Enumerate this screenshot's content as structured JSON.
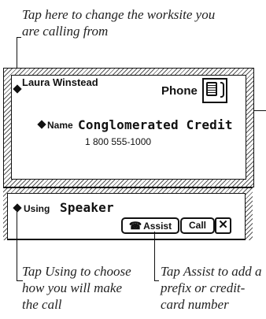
{
  "callouts": {
    "top": "Tap here to change the worksite you are calling from",
    "using": "Tap Using to choose how you will make the call",
    "assist": "Tap Assist to add a prefix or credit-card number"
  },
  "phone_slip": {
    "contact_name": "Laura Winstead",
    "phone_label": "Phone",
    "phone_icon": "telephone-icon",
    "name_label": "Name",
    "name_value": "Conglomerated Credit",
    "number": "1 800 555-1000"
  },
  "call_bar": {
    "using_label": "Using",
    "using_value": "Speaker",
    "assist_glyph": "☎",
    "assist_label": "Assist",
    "call_label": "Call",
    "close_glyph": "✕"
  }
}
